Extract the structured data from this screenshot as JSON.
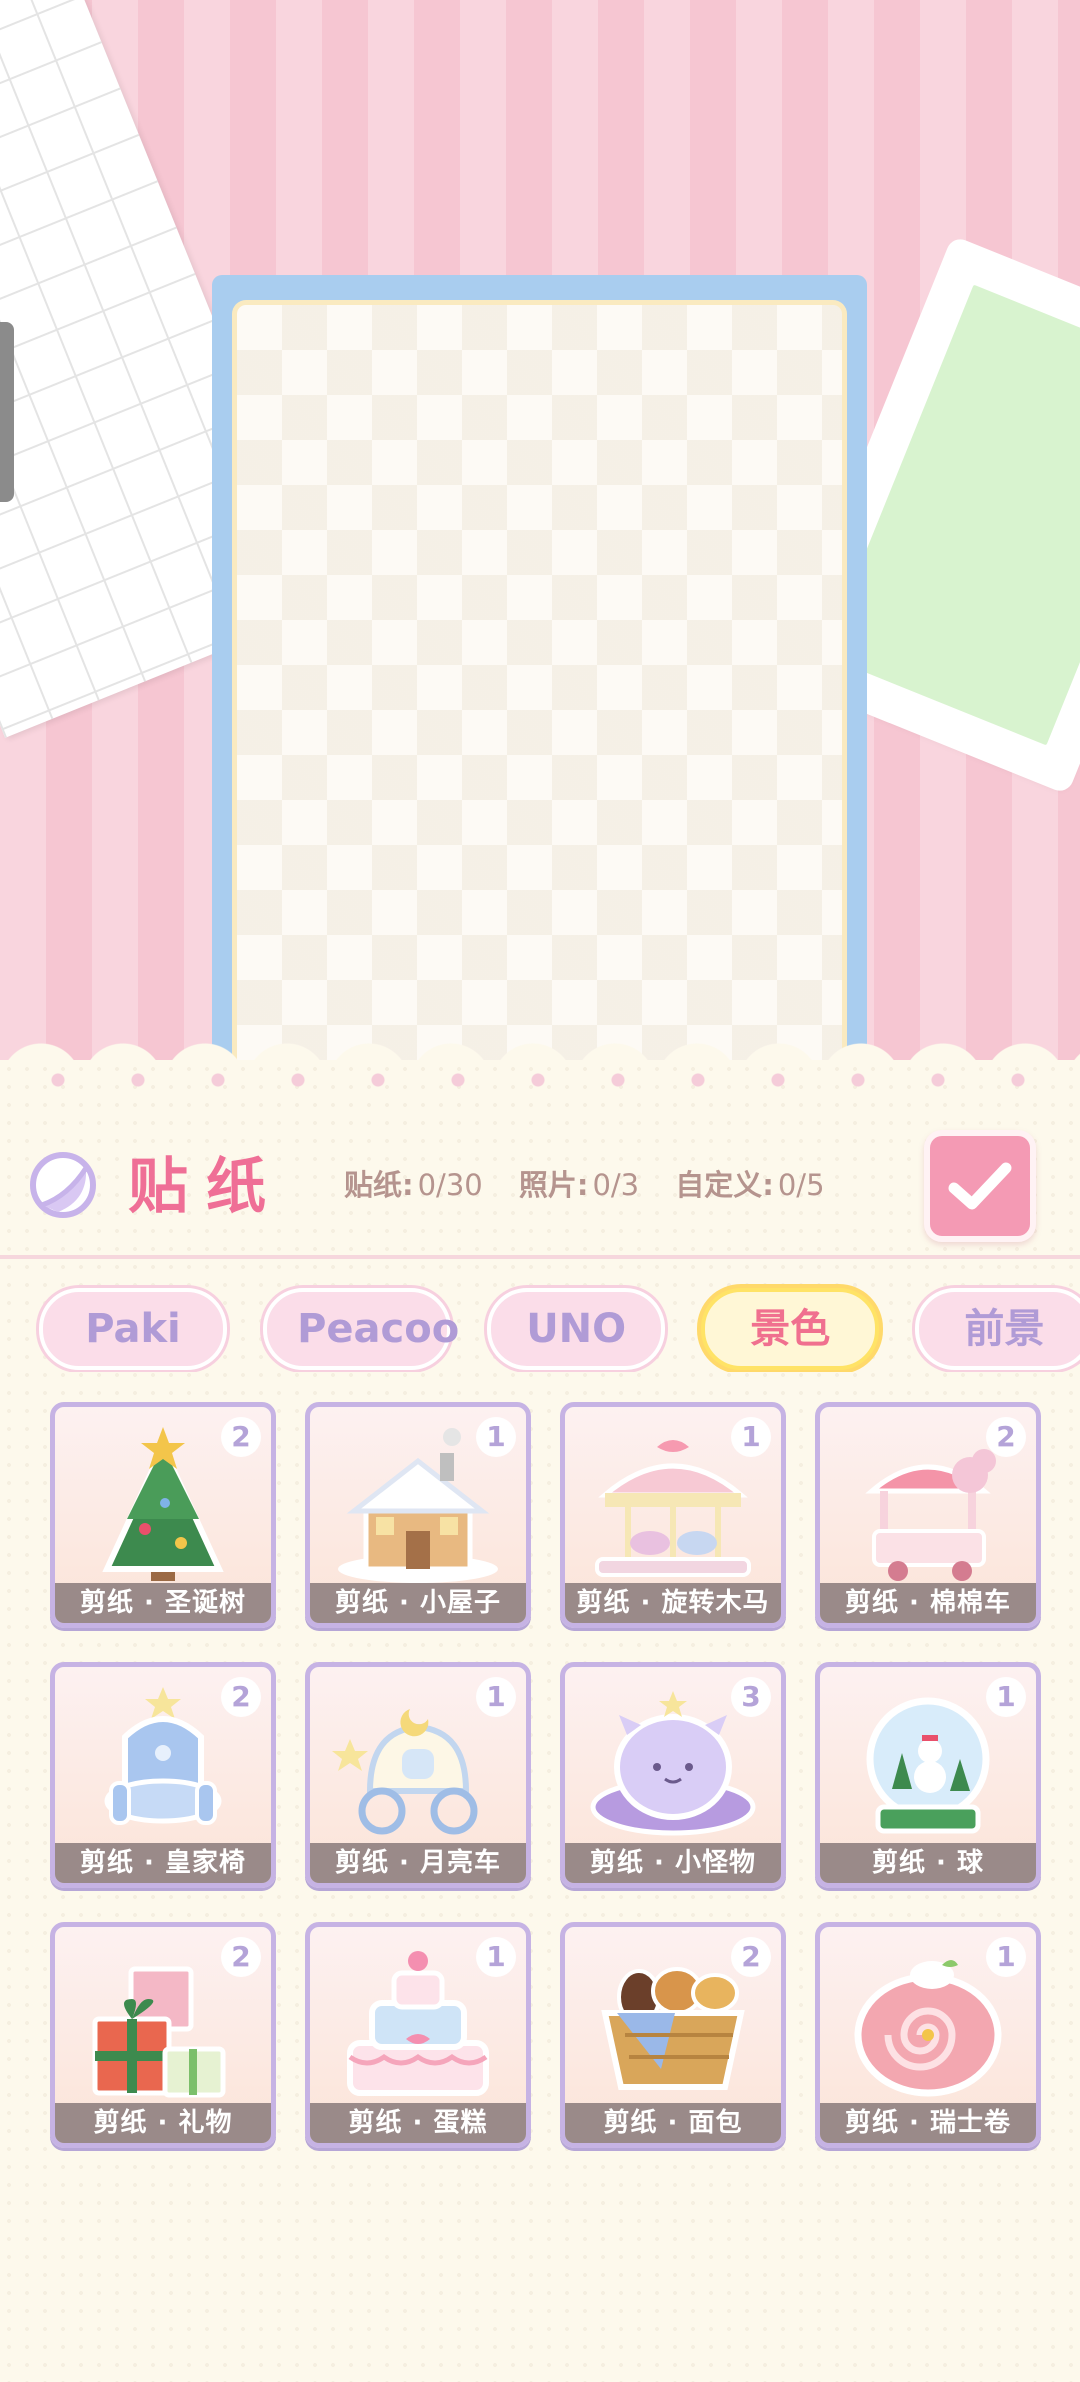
{
  "panel": {
    "title": "贴纸",
    "counters": [
      {
        "label": "贴纸:",
        "value": "0/30"
      },
      {
        "label": "照片:",
        "value": "0/3"
      },
      {
        "label": "自定义:",
        "value": "0/5"
      }
    ]
  },
  "tabs": [
    {
      "label": "Paki",
      "active": false
    },
    {
      "label": "Peacoo",
      "active": false
    },
    {
      "label": "UNO",
      "active": false
    },
    {
      "label": "景色",
      "active": true
    },
    {
      "label": "前景",
      "active": false
    }
  ],
  "stickers": [
    {
      "label": "剪纸 · 圣诞树",
      "count": "2",
      "icon": "christmas-tree-icon"
    },
    {
      "label": "剪纸 · 小屋子",
      "count": "1",
      "icon": "house-icon"
    },
    {
      "label": "剪纸 · 旋转木马",
      "count": "1",
      "icon": "carousel-icon"
    },
    {
      "label": "剪纸 · 棉棉车",
      "count": "2",
      "icon": "candy-cart-icon"
    },
    {
      "label": "剪纸 · 皇家椅",
      "count": "2",
      "icon": "royal-chair-icon"
    },
    {
      "label": "剪纸 · 月亮车",
      "count": "1",
      "icon": "moon-carriage-icon"
    },
    {
      "label": "剪纸 · 小怪物",
      "count": "3",
      "icon": "little-monster-icon"
    },
    {
      "label": "剪纸 · 球",
      "count": "1",
      "icon": "snow-globe-icon"
    },
    {
      "label": "剪纸 · 礼物",
      "count": "2",
      "icon": "gift-icon"
    },
    {
      "label": "剪纸 · 蛋糕",
      "count": "1",
      "icon": "cake-icon"
    },
    {
      "label": "剪纸 · 面包",
      "count": "2",
      "icon": "bread-basket-icon"
    },
    {
      "label": "剪纸 · 瑞士卷",
      "count": "1",
      "icon": "swiss-roll-icon"
    }
  ],
  "colors": {
    "accent_pink": "#ef6f96",
    "tab_lavender": "#b09bd6",
    "active_tab_border": "#ffd96a",
    "card_border": "#c6b3e4"
  }
}
